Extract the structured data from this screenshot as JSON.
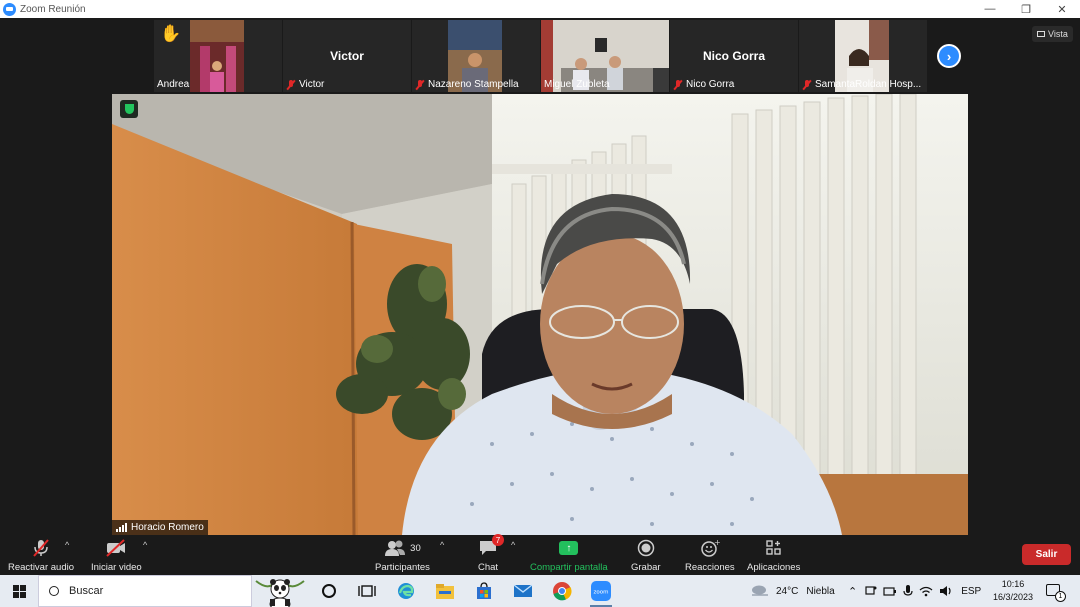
{
  "window": {
    "title": "Zoom Reunión",
    "controls": [
      "—",
      "❐",
      "✕"
    ]
  },
  "view_button": {
    "label": "Vista"
  },
  "participants_strip": [
    {
      "display": "video",
      "label": "Andrea",
      "raised_hand": true,
      "muted": false
    },
    {
      "display": "name",
      "big_name": "Victor",
      "label": "Victor",
      "muted": true
    },
    {
      "display": "video",
      "label": "Nazareno Stampella",
      "muted": true
    },
    {
      "display": "video",
      "label": "Miguel Zubleta",
      "muted": false
    },
    {
      "display": "name",
      "big_name": "Nico Gorra",
      "label": "Nico Gorra",
      "muted": true
    },
    {
      "display": "video",
      "label": "SamantaRoldan Hosp...",
      "muted": true
    }
  ],
  "main_speaker": {
    "name": "Horacio Romero"
  },
  "toolbar": {
    "audio_label": "Reactivar audio",
    "video_label": "Iniciar video",
    "participants_label": "Participantes",
    "participants_count": "30",
    "chat_label": "Chat",
    "chat_badge": "7",
    "share_label": "Compartir pantalla",
    "record_label": "Grabar",
    "reactions_label": "Reacciones",
    "apps_label": "Aplicaciones",
    "leave_label": "Salir",
    "caret": "^"
  },
  "taskbar": {
    "search_placeholder": "Buscar",
    "weather_temp": "24°C",
    "weather_desc": "Niebla",
    "language": "ESP",
    "time": "10:16",
    "date": "16/3/2023",
    "notification_count": "1"
  },
  "colors": {
    "accent": "#2d8cff",
    "share_green": "#23c05d",
    "leave_red": "#c92a2a",
    "mute_red": "#e02828"
  }
}
